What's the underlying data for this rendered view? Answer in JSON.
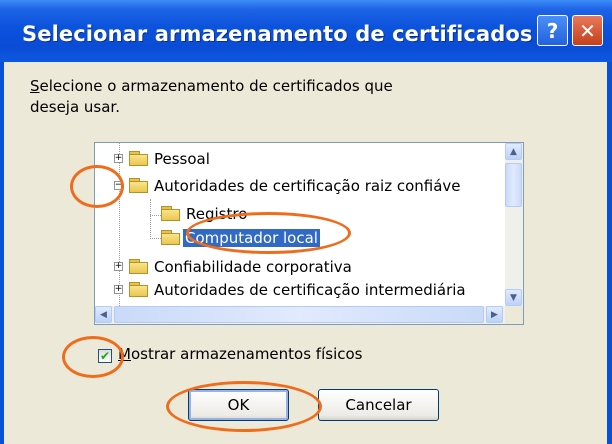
{
  "window": {
    "title": "Selecionar armazenamento de certificados",
    "help_glyph": "?",
    "close_glyph": "✕"
  },
  "instruction": {
    "first_letter": "S",
    "line1_rest": "elecione o armazenamento de certificados que",
    "line2": "deseja usar."
  },
  "tree": {
    "items": [
      {
        "label": "Pessoal",
        "expander": "+"
      },
      {
        "label": "Autoridades de certificação raiz confiáve",
        "expander": "−"
      },
      {
        "label": "Registro"
      },
      {
        "label": "Computador local",
        "selected": true
      },
      {
        "label": "Confiabilidade corporativa",
        "expander": "+"
      },
      {
        "label": "Autoridades de certificação intermediária",
        "expander": "+"
      }
    ]
  },
  "checkbox": {
    "checked": true,
    "mark": "✔",
    "label_first": "M",
    "label_rest": "ostrar armazenamentos físicos"
  },
  "buttons": {
    "ok": "OK",
    "cancel": "Cancelar"
  },
  "colors": {
    "titlebar": "#0a4cd6",
    "selection": "#316ac5",
    "highlight_oval": "#ef6c1c"
  },
  "icons": [
    "help-icon",
    "close-icon",
    "folder-icon",
    "expand-icon",
    "collapse-icon",
    "scroll-up-icon",
    "scroll-down-icon",
    "scroll-left-icon",
    "scroll-right-icon",
    "checkmark-icon"
  ]
}
